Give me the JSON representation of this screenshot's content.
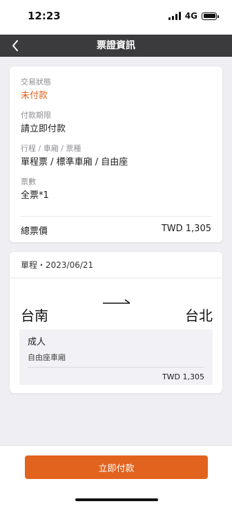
{
  "status_bar": {
    "time": "12:23",
    "network": "4G"
  },
  "nav": {
    "title": "票證資訊"
  },
  "info": {
    "status_label": "交易狀態",
    "status_value": "未付款",
    "deadline_label": "付款期限",
    "deadline_value": "請立即付款",
    "route_label": "行程 / 車廂 / 票種",
    "route_value": "單程票 / 標準車廂 / 自由座",
    "count_label": "票數",
    "count_value": "全票*1",
    "total_label": "總票價",
    "total_value": "TWD 1,305"
  },
  "trip": {
    "header": "單程・2023/06/21",
    "from": "台南",
    "to": "台北",
    "passenger_type": "成人",
    "car_type": "自由座車廂",
    "price": "TWD 1,305"
  },
  "actions": {
    "pay_label": "立即付款"
  },
  "colors": {
    "accent": "#e2631d",
    "nav_bg": "#3b3b3d",
    "page_bg": "#eeeef3"
  }
}
